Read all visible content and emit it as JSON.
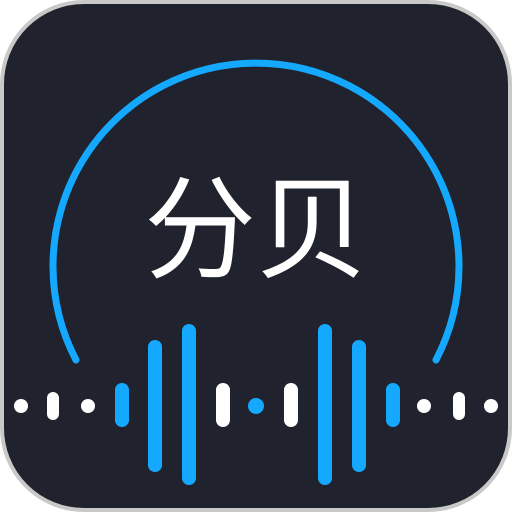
{
  "app_icon": {
    "title": "分贝",
    "icon_names": [
      "app-icon",
      "headphone-arc-icon",
      "sound-wave-icon"
    ]
  },
  "colors": {
    "background_outer": "#ffffff",
    "tile_border": "#c9c9c9",
    "tile_fill": "#20232d",
    "accent_blue": "#14a9ff",
    "white": "#ffffff"
  }
}
